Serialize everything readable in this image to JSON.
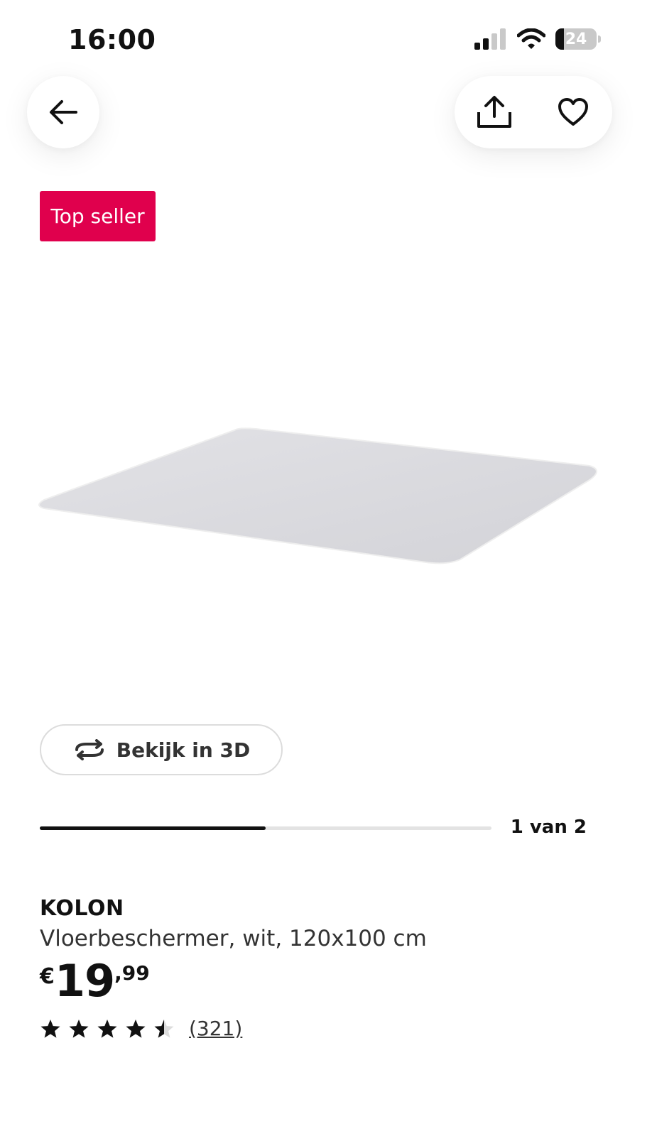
{
  "status_bar": {
    "time": "16:00",
    "battery_level": "24",
    "icons": [
      "signal-icon",
      "wifi-icon",
      "battery-icon"
    ]
  },
  "header": {
    "back_icon": "arrow-left-icon",
    "share_icon": "share-icon",
    "favorite_icon": "heart-icon"
  },
  "badge": {
    "label": "Top seller",
    "color": "#e0004d"
  },
  "media": {
    "view_3d_label": "Bekijk in 3D",
    "view_3d_icon": "rotate-icon",
    "position_label": "1 van 2",
    "progress": 0.5
  },
  "product": {
    "name": "KOLON",
    "description": "Vloerbeschermer, wit, 120x100 cm",
    "price_currency": "€",
    "price_integer": "19",
    "price_decimal": ",99",
    "rating": 4.5,
    "review_count": "(321)"
  }
}
